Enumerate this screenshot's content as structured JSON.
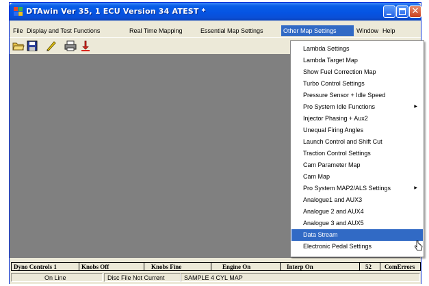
{
  "window": {
    "title": "DTAwin Ver  35, 1 ECU Version  34 ATEST  *",
    "titlebar_color": "#0a5fe8"
  },
  "menu": {
    "items": [
      "File",
      "Display and Test Functions",
      "Real Time Mapping",
      "Essential Map Settings",
      "Other Map Settings",
      "Window",
      "Help"
    ],
    "active_index": 4
  },
  "toolbar": {
    "icons": [
      "open-folder-icon",
      "save-disk-icon",
      "pencil-icon",
      "print-icon",
      "download-arrow-icon"
    ]
  },
  "dropdown": {
    "items": [
      {
        "label": "Lambda Settings"
      },
      {
        "label": "Lambda Target Map"
      },
      {
        "label": "Show Fuel Correction Map"
      },
      {
        "label": "Turbo Control Settings"
      },
      {
        "label": "Pressure Sensor + Idle Speed"
      },
      {
        "label": "Pro System Idle Functions",
        "submenu": true
      },
      {
        "label": "Injector Phasing  + Aux2"
      },
      {
        "label": "Unequal Firing Angles"
      },
      {
        "label": "Launch Control and Shift Cut"
      },
      {
        "label": "Traction Control Settings"
      },
      {
        "label": "Cam Parameter Map"
      },
      {
        "label": "Cam Map"
      },
      {
        "label": "Pro System MAP2/ALS Settings",
        "submenu": true
      },
      {
        "label": "Analogue1 and AUX3"
      },
      {
        "label": "Analogue 2 and AUX4"
      },
      {
        "label": "Analogue 3 and AUX5"
      },
      {
        "label": "Data Stream",
        "highlighted": true
      },
      {
        "label": "Electronic Pedal Settings"
      }
    ],
    "submenu_glyph": "▶"
  },
  "status_row1": {
    "dyno_controls": "Dyno Controls  1",
    "knobs_off": "Knobs Off",
    "knobs_fine": "Knobs Fine",
    "engine_on": "Engine On",
    "interp_on": "Interp On",
    "value_52": "52",
    "com_errors": "ComErrors"
  },
  "status_row2": {
    "online": "On Line",
    "disc_file": "Disc File Not Current",
    "map_name": "SAMPLE 4 CYL MAP"
  },
  "colors": {
    "accent_highlight": "#316ac5",
    "workspace": "#808080",
    "chrome": "#ece9d8"
  }
}
